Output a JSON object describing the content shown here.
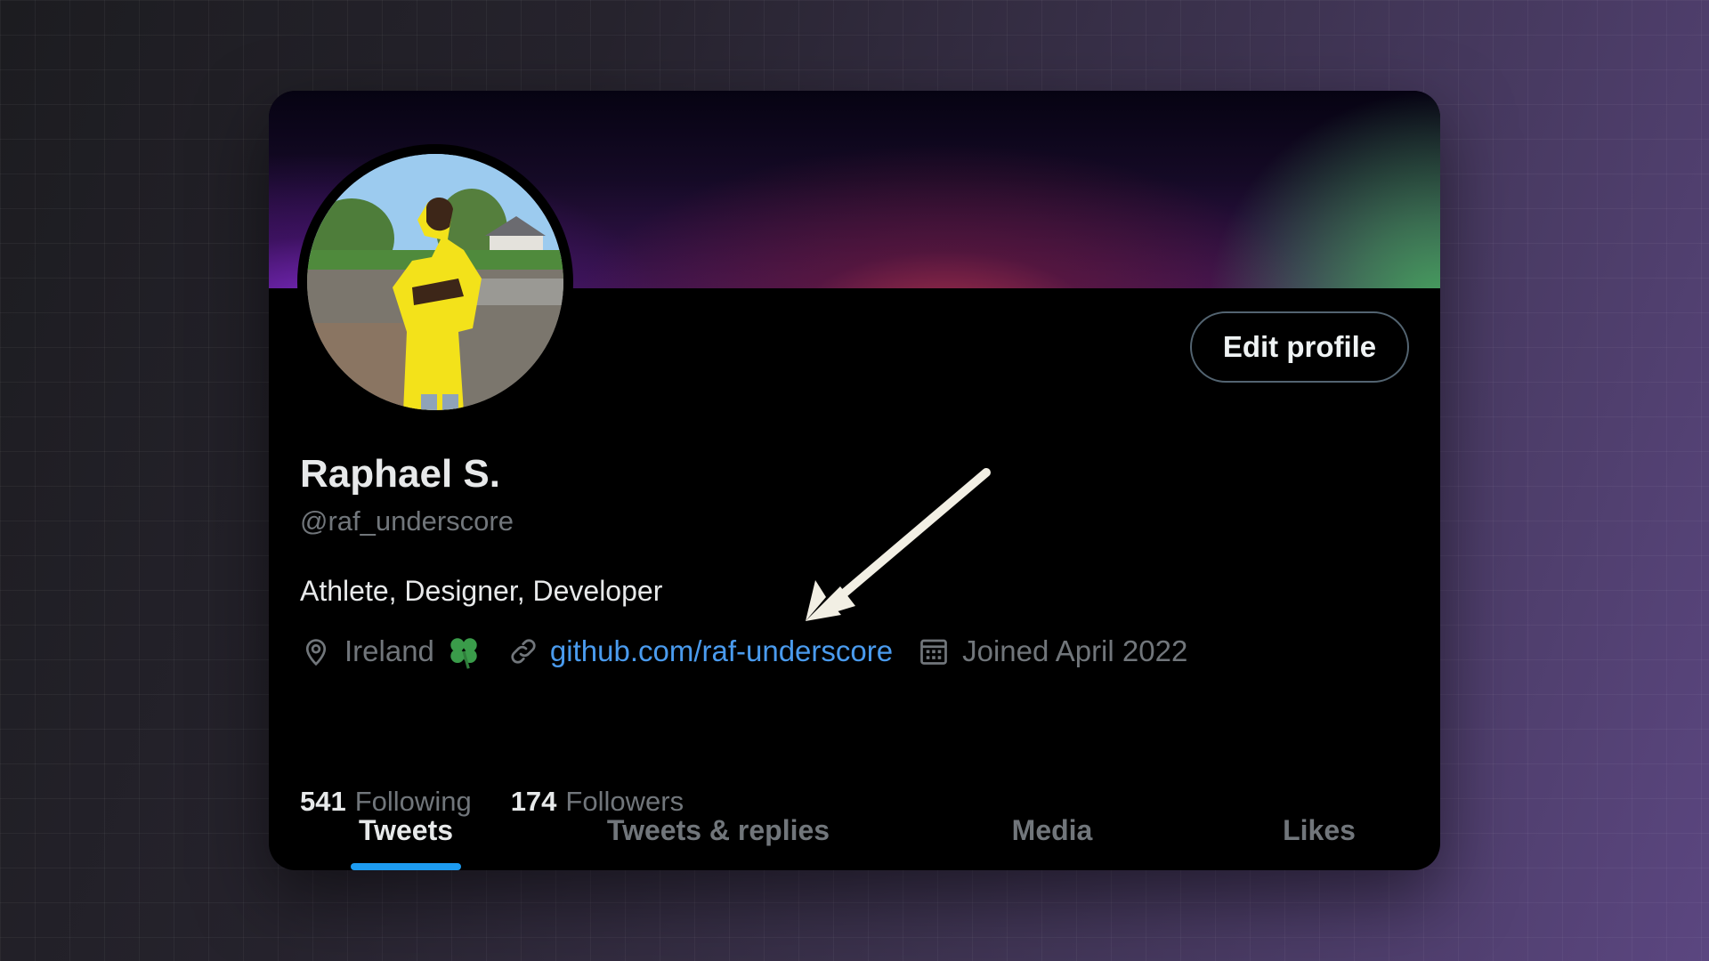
{
  "profile": {
    "name": "Raphael S.",
    "handle": "@raf_underscore",
    "bio": "Athlete, Designer, Developer",
    "location": "Ireland",
    "website": "github.com/raf-underscore",
    "joined": "Joined April 2022",
    "edit_label": "Edit profile"
  },
  "stats": {
    "following_count": "541",
    "following_label": "Following",
    "followers_count": "174",
    "followers_label": "Followers"
  },
  "tabs": [
    {
      "label": "Tweets",
      "active": true
    },
    {
      "label": "Tweets & replies",
      "active": false
    },
    {
      "label": "Media",
      "active": false
    },
    {
      "label": "Likes",
      "active": false
    }
  ],
  "icons": {
    "location": "map-pin-icon",
    "location_flag": "four-leaf-clover-icon",
    "website": "link-icon",
    "joined": "calendar-icon"
  },
  "colors": {
    "accent": "#1d9bf0",
    "link": "#4a9bee",
    "clover": "#3a9c4a"
  }
}
